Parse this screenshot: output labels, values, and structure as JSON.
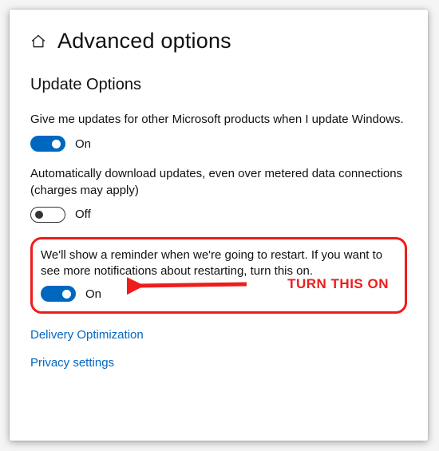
{
  "header": {
    "title": "Advanced options",
    "home_icon": "home-icon"
  },
  "section": {
    "title": "Update Options"
  },
  "options": [
    {
      "desc": "Give me updates for other Microsoft products when I update Windows.",
      "state": "On",
      "on": true
    },
    {
      "desc": "Automatically download updates, even over metered data connections (charges may apply)",
      "state": "Off",
      "on": false
    },
    {
      "desc": "We'll show a reminder when we're going to restart. If you want to see more notifications about restarting, turn this on.",
      "state": "On",
      "on": true
    }
  ],
  "annotation": {
    "label": "TURN THIS ON"
  },
  "links": {
    "delivery": "Delivery Optimization",
    "privacy": "Privacy settings"
  },
  "colors": {
    "accent": "#0067c0",
    "highlight": "#ef1c1c"
  }
}
